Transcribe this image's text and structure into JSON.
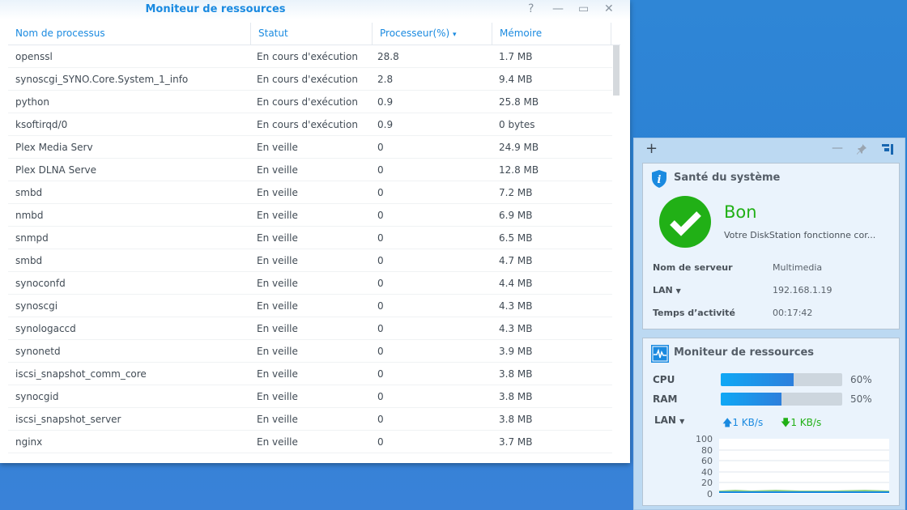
{
  "window": {
    "title": "Moniteur de ressources",
    "help": "?",
    "minimize": "—",
    "maximize": "▭",
    "close": "✕"
  },
  "table": {
    "headers": [
      "Nom de processus",
      "Statut",
      "Processeur(%)",
      "Mémoire"
    ],
    "sort_icon": "▾",
    "rows": [
      [
        "openssl",
        "En cours d'exécution",
        "28.8",
        "1.7 MB"
      ],
      [
        "synoscgi_SYNO.Core.System_1_info",
        "En cours d'exécution",
        "2.8",
        "9.4 MB"
      ],
      [
        "python",
        "En cours d'exécution",
        "0.9",
        "25.8 MB"
      ],
      [
        "ksoftirqd/0",
        "En cours d'exécution",
        "0.9",
        "0 bytes"
      ],
      [
        "Plex Media Serv",
        "En veille",
        "0",
        "24.9 MB"
      ],
      [
        "Plex DLNA Serve",
        "En veille",
        "0",
        "12.8 MB"
      ],
      [
        "smbd",
        "En veille",
        "0",
        "7.2 MB"
      ],
      [
        "nmbd",
        "En veille",
        "0",
        "6.9 MB"
      ],
      [
        "snmpd",
        "En veille",
        "0",
        "6.5 MB"
      ],
      [
        "smbd",
        "En veille",
        "0",
        "4.7 MB"
      ],
      [
        "synoconfd",
        "En veille",
        "0",
        "4.4 MB"
      ],
      [
        "synoscgi",
        "En veille",
        "0",
        "4.3 MB"
      ],
      [
        "synologaccd",
        "En veille",
        "0",
        "4.3 MB"
      ],
      [
        "synonetd",
        "En veille",
        "0",
        "3.9 MB"
      ],
      [
        "iscsi_snapshot_comm_core",
        "En veille",
        "0",
        "3.8 MB"
      ],
      [
        "synocgid",
        "En veille",
        "0",
        "3.8 MB"
      ],
      [
        "iscsi_snapshot_server",
        "En veille",
        "0",
        "3.8 MB"
      ],
      [
        "nginx",
        "En veille",
        "0",
        "3.7 MB"
      ]
    ]
  },
  "widgets": {
    "add": "+",
    "minimize": "—",
    "health": {
      "title": "Santé du système",
      "status": "Bon",
      "message": "Votre DiskStation fonctionne cor...",
      "server_label": "Nom de serveur",
      "server": "Multimedia",
      "lan_label": "LAN",
      "ip": "192.168.1.19",
      "uptime_label": "Temps d’activité",
      "uptime": "00:17:42",
      "status_color": "#21b016"
    },
    "resource": {
      "title": "Moniteur de ressources",
      "cpu_label": "CPU",
      "cpu_percent": 60,
      "cpu_text": "60%",
      "ram_label": "RAM",
      "ram_percent": 50,
      "ram_text": "50%",
      "lan_label": "LAN",
      "upload": "1 KB/s",
      "download": "1 KB/s",
      "y_ticks": [
        "100",
        "80",
        "60",
        "40",
        "20",
        "0"
      ]
    }
  }
}
